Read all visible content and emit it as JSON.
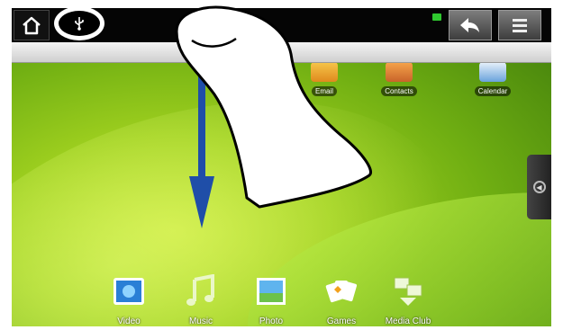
{
  "top_bar": {
    "home_icon": "home-icon",
    "usb_icon": "usb-icon",
    "notification_color": "#2fc92f",
    "back_icon": "back-arrow-icon",
    "menu_icon": "menu-icon"
  },
  "home_shortcuts": [
    {
      "label": "Email",
      "icon": "email-icon"
    },
    {
      "label": "Contacts",
      "icon": "contacts-icon"
    },
    {
      "label": "Calendar",
      "icon": "calendar-icon"
    }
  ],
  "dock": [
    {
      "label": "Video",
      "icon": "video-icon"
    },
    {
      "label": "Music",
      "icon": "music-icon"
    },
    {
      "label": "Photo",
      "icon": "photo-icon"
    },
    {
      "label": "Games",
      "icon": "games-icon"
    },
    {
      "label": "Media Club",
      "icon": "media-club-icon"
    }
  ],
  "gesture": {
    "type": "swipe-down",
    "arrow_color": "#1f4ea8"
  }
}
